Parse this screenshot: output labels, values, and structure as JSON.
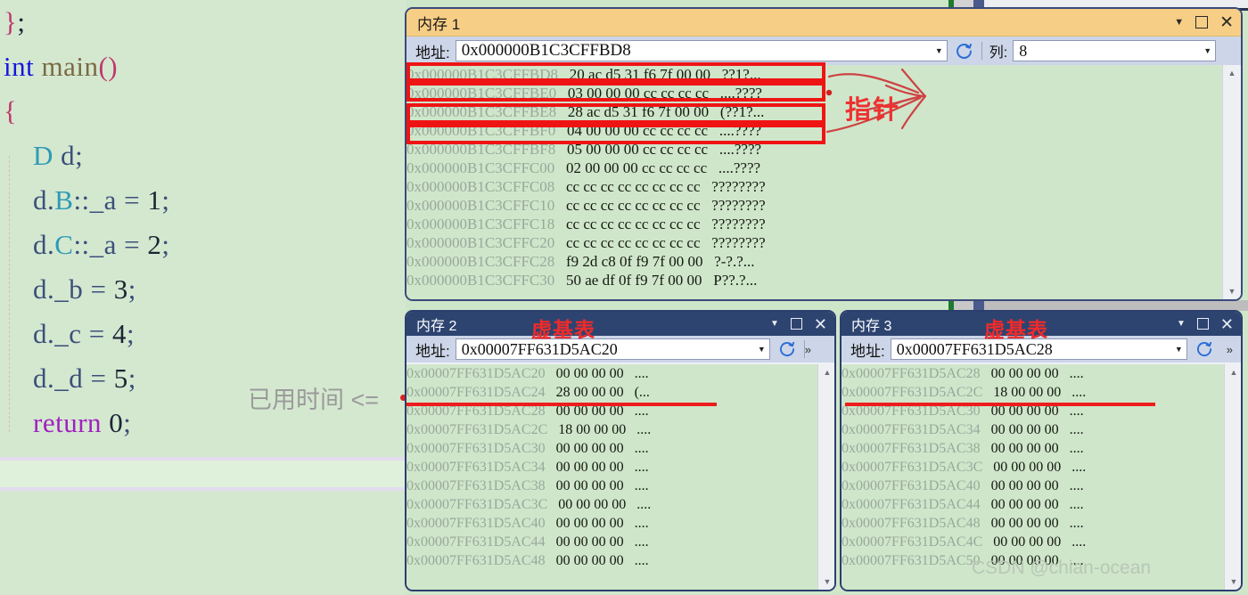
{
  "editor": {
    "lines": [
      {
        "tokens": [
          {
            "t": "}",
            "c": "brace"
          },
          {
            "t": ";",
            "c": "plain"
          }
        ]
      },
      {
        "tokens": [
          {
            "t": "int",
            "c": "kw-blue"
          },
          {
            "t": " ",
            "c": "plain"
          },
          {
            "t": "main",
            "c": "fn"
          },
          {
            "t": "()",
            "c": "brace"
          }
        ]
      },
      {
        "tokens": [
          {
            "t": "{",
            "c": "brace"
          }
        ]
      },
      {
        "tokens": [
          {
            "t": "    ",
            "c": "plain"
          },
          {
            "t": "D",
            "c": "type"
          },
          {
            "t": " d;",
            "c": "var"
          }
        ]
      },
      {
        "tokens": [
          {
            "t": "    d.",
            "c": "var"
          },
          {
            "t": "B",
            "c": "type"
          },
          {
            "t": "::_a = ",
            "c": "var"
          },
          {
            "t": "1",
            "c": "num"
          },
          {
            "t": ";",
            "c": "var"
          }
        ]
      },
      {
        "tokens": [
          {
            "t": "    d.",
            "c": "var"
          },
          {
            "t": "C",
            "c": "type"
          },
          {
            "t": "::_a = ",
            "c": "var"
          },
          {
            "t": "2",
            "c": "num"
          },
          {
            "t": ";",
            "c": "var"
          }
        ]
      },
      {
        "tokens": [
          {
            "t": "    d._b = ",
            "c": "var"
          },
          {
            "t": "3",
            "c": "num"
          },
          {
            "t": ";",
            "c": "var"
          }
        ]
      },
      {
        "tokens": [
          {
            "t": "    d._c = ",
            "c": "var"
          },
          {
            "t": "4",
            "c": "num"
          },
          {
            "t": ";",
            "c": "var"
          }
        ]
      },
      {
        "tokens": [
          {
            "t": "    d._d = ",
            "c": "var"
          },
          {
            "t": "5",
            "c": "num"
          },
          {
            "t": ";",
            "c": "var"
          }
        ]
      },
      {
        "tokens": [
          {
            "t": "    ",
            "c": "plain"
          },
          {
            "t": "return",
            "c": "kw-purple"
          },
          {
            "t": " ",
            "c": "plain"
          },
          {
            "t": "0",
            "c": "num"
          },
          {
            "t": ";",
            "c": "var"
          }
        ]
      },
      {
        "tokens": [
          {
            "t": "}",
            "c": "brace"
          }
        ]
      }
    ],
    "elapsed_hint": "已用时间 <="
  },
  "mem1": {
    "title": "内存 1",
    "address_label": "地址:",
    "address_value": "0x000000B1C3CFFBD8",
    "column_label": "列:",
    "column_value": "8",
    "refresh_icon": "refresh-icon",
    "caret_icon": "chevron-down-icon",
    "restore_icon": "restore-window-icon",
    "close_icon": "close-icon",
    "rows": [
      {
        "addr": "0x000000B1C3CFFBD8",
        "bytes": "20 ac d5 31 f6 7f 00 00",
        "ascii": "??1?..."
      },
      {
        "addr": "0x000000B1C3CFFBE0",
        "bytes": "03 00 00 00 cc cc cc cc",
        "ascii": "....????"
      },
      {
        "addr": "0x000000B1C3CFFBE8",
        "bytes": "28 ac d5 31 f6 7f 00 00",
        "ascii": "(??1?..."
      },
      {
        "addr": "0x000000B1C3CFFBF0",
        "bytes": "04 00 00 00 cc cc cc cc",
        "ascii": "....????"
      },
      {
        "addr": "0x000000B1C3CFFBF8",
        "bytes": "05 00 00 00 cc cc cc cc",
        "ascii": "....????"
      },
      {
        "addr": "0x000000B1C3CFFC00",
        "bytes": "02 00 00 00 cc cc cc cc",
        "ascii": "....????"
      },
      {
        "addr": "0x000000B1C3CFFC08",
        "bytes": "cc cc cc cc cc cc cc cc",
        "ascii": "????????"
      },
      {
        "addr": "0x000000B1C3CFFC10",
        "bytes": "cc cc cc cc cc cc cc cc",
        "ascii": "????????"
      },
      {
        "addr": "0x000000B1C3CFFC18",
        "bytes": "cc cc cc cc cc cc cc cc",
        "ascii": "????????"
      },
      {
        "addr": "0x000000B1C3CFFC20",
        "bytes": "cc cc cc cc cc cc cc cc",
        "ascii": "????????"
      },
      {
        "addr": "0x000000B1C3CFFC28",
        "bytes": "f9 2d c8 0f f9 7f 00 00",
        "ascii": "?-?.?..."
      },
      {
        "addr": "0x000000B1C3CFFC30",
        "bytes": "50 ae df 0f f9 7f 00 00",
        "ascii": "P??.?..."
      }
    ]
  },
  "annotations": {
    "pointer_label": "指针",
    "vbtable_label_2": "虚基表",
    "vbtable_label_3": "虚基表"
  },
  "mem2": {
    "title": "内存 2",
    "address_label": "地址:",
    "address_value": "0x00007FF631D5AC20",
    "rows": [
      {
        "addr": "0x00007FF631D5AC20",
        "bytes": "00 00 00 00",
        "ascii": "...."
      },
      {
        "addr": "0x00007FF631D5AC24",
        "bytes": "28 00 00 00",
        "ascii": "(..."
      },
      {
        "addr": "0x00007FF631D5AC28",
        "bytes": "00 00 00 00",
        "ascii": "...."
      },
      {
        "addr": "0x00007FF631D5AC2C",
        "bytes": "18 00 00 00",
        "ascii": "...."
      },
      {
        "addr": "0x00007FF631D5AC30",
        "bytes": "00 00 00 00",
        "ascii": "...."
      },
      {
        "addr": "0x00007FF631D5AC34",
        "bytes": "00 00 00 00",
        "ascii": "...."
      },
      {
        "addr": "0x00007FF631D5AC38",
        "bytes": "00 00 00 00",
        "ascii": "...."
      },
      {
        "addr": "0x00007FF631D5AC3C",
        "bytes": "00 00 00 00",
        "ascii": "...."
      },
      {
        "addr": "0x00007FF631D5AC40",
        "bytes": "00 00 00 00",
        "ascii": "...."
      },
      {
        "addr": "0x00007FF631D5AC44",
        "bytes": "00 00 00 00",
        "ascii": "...."
      },
      {
        "addr": "0x00007FF631D5AC48",
        "bytes": "00 00 00 00",
        "ascii": "...."
      }
    ]
  },
  "mem3": {
    "title": "内存 3",
    "address_label": "地址:",
    "address_value": "0x00007FF631D5AC28",
    "rows": [
      {
        "addr": "0x00007FF631D5AC28",
        "bytes": "00 00 00 00",
        "ascii": "...."
      },
      {
        "addr": "0x00007FF631D5AC2C",
        "bytes": "18 00 00 00",
        "ascii": "...."
      },
      {
        "addr": "0x00007FF631D5AC30",
        "bytes": "00 00 00 00",
        "ascii": "...."
      },
      {
        "addr": "0x00007FF631D5AC34",
        "bytes": "00 00 00 00",
        "ascii": "...."
      },
      {
        "addr": "0x00007FF631D5AC38",
        "bytes": "00 00 00 00",
        "ascii": "...."
      },
      {
        "addr": "0x00007FF631D5AC3C",
        "bytes": "00 00 00 00",
        "ascii": "...."
      },
      {
        "addr": "0x00007FF631D5AC40",
        "bytes": "00 00 00 00",
        "ascii": "...."
      },
      {
        "addr": "0x00007FF631D5AC44",
        "bytes": "00 00 00 00",
        "ascii": "...."
      },
      {
        "addr": "0x00007FF631D5AC48",
        "bytes": "00 00 00 00",
        "ascii": "...."
      },
      {
        "addr": "0x00007FF631D5AC4C",
        "bytes": "00 00 00 00",
        "ascii": "...."
      },
      {
        "addr": "0x00007FF631D5AC50",
        "bytes": "00 00 00 00",
        "ascii": "...."
      }
    ]
  },
  "watermark": "CSDN @chian-ocean",
  "colors": {
    "annotation_red": "#ee2b2b",
    "mem1_title_bg": "#f7ce85",
    "mem23_title_bg": "#2e4470",
    "hex_bg": "#cfe6cb",
    "editor_bg": "#d4e8d0"
  }
}
